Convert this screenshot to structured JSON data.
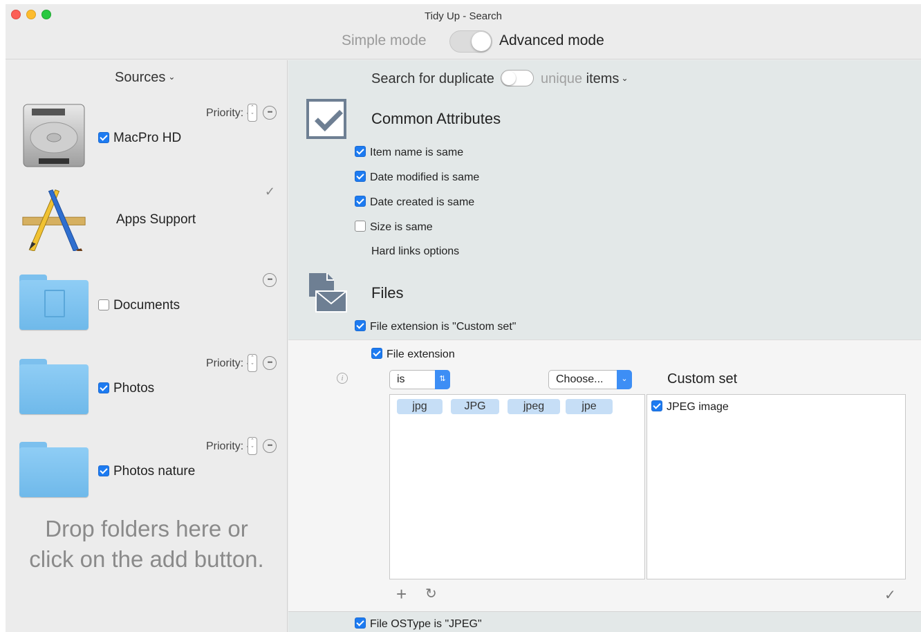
{
  "window": {
    "title": "Tidy Up - Search"
  },
  "mode": {
    "simple_label": "Simple mode",
    "advanced_label": "Advanced mode",
    "selected": "advanced"
  },
  "sources": {
    "header": "Sources",
    "items": [
      {
        "name": "MacPro HD",
        "checked": true,
        "priority_label": "Priority: -",
        "icon": "hard-drive-icon"
      },
      {
        "name": "Apps Support",
        "checked": null,
        "icon": "applications-icon"
      },
      {
        "name": "Documents",
        "checked": false,
        "icon": "documents-folder-icon"
      },
      {
        "name": "Photos",
        "checked": true,
        "priority_label": "Priority: -",
        "icon": "folder-icon"
      },
      {
        "name": "Photos nature",
        "checked": true,
        "priority_label": "Priority: -",
        "icon": "folder-icon"
      }
    ],
    "drop_message_line1": "Drop folders here or",
    "drop_message_line2": "click on the add button."
  },
  "search": {
    "prefix": "Search for duplicate",
    "unique_label": "unique",
    "suffix": "items",
    "mode": "duplicate"
  },
  "common_attributes": {
    "title": "Common Attributes",
    "items": [
      {
        "label": "Item name is same",
        "checked": true
      },
      {
        "label": "Date modified is same",
        "checked": true
      },
      {
        "label": "Date created is same",
        "checked": true
      },
      {
        "label": "Size is same",
        "checked": false
      }
    ],
    "hard_links_label": "Hard links options"
  },
  "files": {
    "title": "Files",
    "extension_rule": {
      "label": "File extension is \"Custom set\"",
      "checked": true
    },
    "file_extension": {
      "label": "File extension",
      "checked": true
    },
    "operator": "is",
    "choose_label": "Choose...",
    "custom_set_label": "Custom set",
    "tokens": [
      "jpg",
      "JPG",
      "jpeg",
      "jpe"
    ],
    "set_items": [
      {
        "label": "JPEG image",
        "checked": true
      }
    ],
    "ostype_rule": {
      "label": "File OSType is \"JPEG\"",
      "checked": true
    }
  },
  "colors": {
    "accent": "#1d7bf1",
    "panel_bg": "#e3e8e8",
    "token_bg": "#c6def6"
  }
}
